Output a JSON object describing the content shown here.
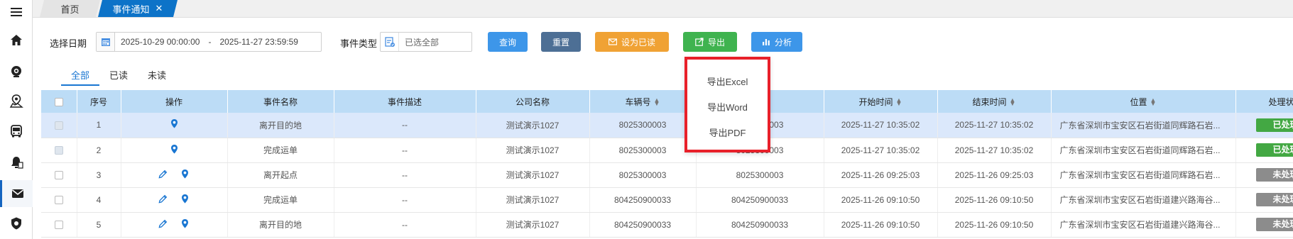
{
  "sidebar": {
    "items": [
      {
        "icon": "menu-icon"
      },
      {
        "icon": "home-icon"
      },
      {
        "icon": "camera-icon"
      },
      {
        "icon": "map-pin-icon"
      },
      {
        "icon": "bus-icon"
      },
      {
        "icon": "alarm-bell-icon"
      },
      {
        "icon": "mail-icon",
        "active": true
      },
      {
        "icon": "shield-icon"
      }
    ]
  },
  "tabs": {
    "home": "首页",
    "active": "事件通知",
    "close": "✕"
  },
  "filters": {
    "date_label": "选择日期",
    "date_start": "2025-10-29 00:00:00",
    "date_sep": "-",
    "date_end": "2025-11-27 23:59:59",
    "type_label": "事件类型",
    "type_value": "已选全部"
  },
  "buttons": {
    "query": "查询",
    "reset": "重置",
    "mark_read": "设为已读",
    "export": "导出",
    "analyze": "分析"
  },
  "colors": {
    "query": "#3d96e9",
    "reset": "#4d6f95",
    "mark_read": "#f0a234",
    "export": "#3fb34f",
    "analyze": "#3d96e9",
    "done": "#43a843",
    "pending": "#8c8c8c"
  },
  "subtabs": [
    "全部",
    "已读",
    "未读"
  ],
  "table": {
    "headers": [
      "序号",
      "操作",
      "事件名称",
      "事件描述",
      "公司名称",
      "车辆号",
      "",
      "开始时间",
      "结束时间",
      "位置",
      "处理状态"
    ],
    "rows": [
      {
        "no": "1",
        "edit": false,
        "name": "离开目的地",
        "desc": "--",
        "company": "测试演示1027",
        "car": "8025300003",
        "col7": "8025300003",
        "start": "2025-11-27 10:35:02",
        "end": "2025-11-27 10:35:02",
        "loc": "广东省深圳市宝安区石岩街道同辉路石岩...",
        "status": "已处理",
        "done": true
      },
      {
        "no": "2",
        "edit": false,
        "name": "完成运单",
        "desc": "--",
        "company": "测试演示1027",
        "car": "8025300003",
        "col7": "8025300003",
        "start": "2025-11-27 10:35:02",
        "end": "2025-11-27 10:35:02",
        "loc": "广东省深圳市宝安区石岩街道同辉路石岩...",
        "status": "已处理",
        "done": true
      },
      {
        "no": "3",
        "edit": true,
        "name": "离开起点",
        "desc": "--",
        "company": "测试演示1027",
        "car": "8025300003",
        "col7": "8025300003",
        "start": "2025-11-26 09:25:03",
        "end": "2025-11-26 09:25:03",
        "loc": "广东省深圳市宝安区石岩街道同辉路石岩...",
        "status": "未处理",
        "done": false
      },
      {
        "no": "4",
        "edit": true,
        "name": "完成运单",
        "desc": "--",
        "company": "测试演示1027",
        "car": "804250900033",
        "col7": "804250900033",
        "start": "2025-11-26 09:10:50",
        "end": "2025-11-26 09:10:50",
        "loc": "广东省深圳市宝安区石岩街道建兴路海谷...",
        "status": "未处理",
        "done": false
      },
      {
        "no": "5",
        "edit": true,
        "name": "离开目的地",
        "desc": "--",
        "company": "测试演示1027",
        "car": "804250900033",
        "col7": "804250900033",
        "start": "2025-11-26 09:10:50",
        "end": "2025-11-26 09:10:50",
        "loc": "广东省深圳市宝安区石岩街道建兴路海谷...",
        "status": "未处理",
        "done": false
      }
    ]
  },
  "export_menu": [
    "导出Excel",
    "导出Word",
    "导出PDF"
  ]
}
